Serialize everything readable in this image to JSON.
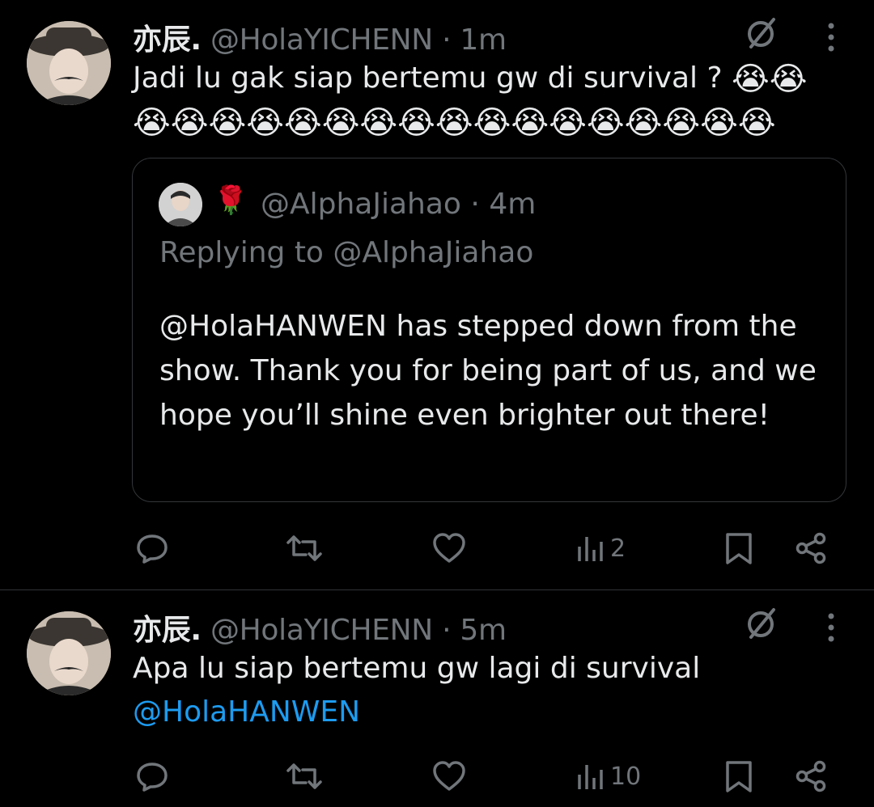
{
  "tweets": [
    {
      "author_name": "亦辰.",
      "author_handle": "@HolaYICHENN",
      "time": "1m",
      "text": "Jadi lu gak siap bertemu gw di survival  ? ",
      "emoji_line1": "😭😭",
      "emoji_line2": "😭😭😭😭😭😭😭😭😭😭😭😭😭😭😭😭😭",
      "quote": {
        "author_emoji": "🌹",
        "author_handle": "@AlphaJiahao",
        "time": "4m",
        "replying_to": "Replying to @AlphaJiahao",
        "text": "@HolaHANWEN has stepped down from the show. Thank you for being part of us, and we hope you’ll shine even brighter out there!"
      },
      "views": "2"
    },
    {
      "author_name": "亦辰.",
      "author_handle": "@HolaYICHENN",
      "time": "5m",
      "text": "Apa lu siap bertemu gw lagi di survival",
      "mention": "@HolaHANWEN",
      "views": "10"
    }
  ],
  "separator": "·",
  "colors": {
    "background": "#000000",
    "text": "#e7e9ea",
    "muted": "#71767b",
    "link": "#1d9bf0",
    "border": "#2f3336"
  }
}
